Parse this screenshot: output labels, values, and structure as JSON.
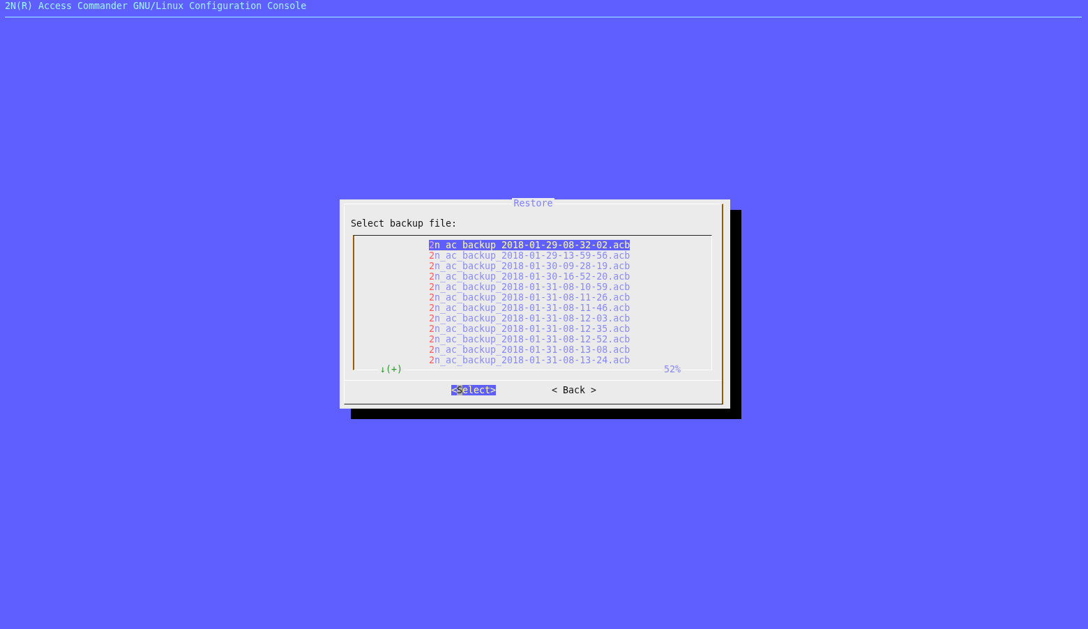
{
  "backtitle": "2N(R) Access Commander GNU/Linux Configuration Console",
  "dialog": {
    "title": "Restore",
    "prompt": "Select backup file:",
    "items": [
      {
        "label": "2n_ac_backup_2018-01-29-08-32-02.acb",
        "selected": true
      },
      {
        "label": "2n_ac_backup_2018-01-29-13-59-56.acb",
        "selected": false
      },
      {
        "label": "2n_ac_backup_2018-01-30-09-28-19.acb",
        "selected": false
      },
      {
        "label": "2n_ac_backup_2018-01-30-16-52-20.acb",
        "selected": false
      },
      {
        "label": "2n_ac_backup_2018-01-31-08-10-59.acb",
        "selected": false
      },
      {
        "label": "2n_ac_backup_2018-01-31-08-11-26.acb",
        "selected": false
      },
      {
        "label": "2n_ac_backup_2018-01-31-08-11-46.acb",
        "selected": false
      },
      {
        "label": "2n_ac_backup_2018-01-31-08-12-03.acb",
        "selected": false
      },
      {
        "label": "2n_ac_backup_2018-01-31-08-12-35.acb",
        "selected": false
      },
      {
        "label": "2n_ac_backup_2018-01-31-08-12-52.acb",
        "selected": false
      },
      {
        "label": "2n_ac_backup_2018-01-31-08-13-08.acb",
        "selected": false
      },
      {
        "label": "2n_ac_backup_2018-01-31-08-13-24.acb",
        "selected": false
      }
    ],
    "scroll_indicator": "↓(+)",
    "scroll_percent": "52%",
    "buttons": [
      {
        "label": "<Select>",
        "selected": true
      },
      {
        "label": "< Back >",
        "selected": false
      }
    ]
  }
}
